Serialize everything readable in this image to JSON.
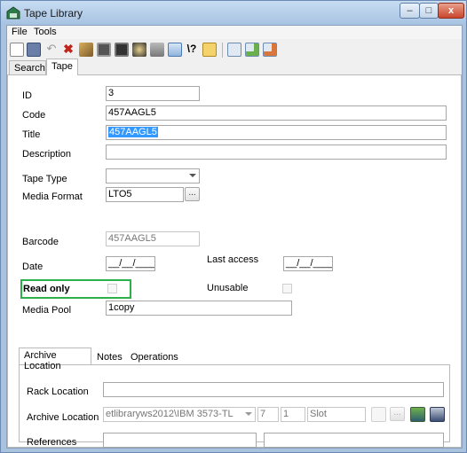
{
  "window": {
    "title": "Tape Library",
    "buttons": {
      "minimize": "–",
      "maximize": "□",
      "close": "x"
    }
  },
  "menu": [
    "File",
    "Tools"
  ],
  "toolbar": [
    "new-icon",
    "save-icon",
    "undo-icon",
    "delete-icon",
    "brush-icon",
    "print-icon",
    "print-preview-icon",
    "process-icon",
    "copy-icon",
    "screen-icon",
    "help-icon",
    "lock-icon",
    "tape-icon",
    "tape-add-icon",
    "tape-remove-icon"
  ],
  "tabs": [
    "Search",
    "Tape"
  ],
  "form": {
    "id_label": "ID",
    "id_value": "3",
    "code_label": "Code",
    "code_value": "457AAGL5",
    "title_label": "Title",
    "title_value": "457AAGL5",
    "description_label": "Description",
    "description_value": "",
    "tape_type_label": "Tape Type",
    "tape_type_value": "",
    "media_format_label": "Media Format",
    "media_format_value": "LTO5",
    "ellipsis": "...",
    "barcode_label": "Barcode",
    "barcode_value": "457AAGL5",
    "date_label": "Date",
    "date_value": "__/__/____",
    "last_access_label": "Last access",
    "last_access_value": "__/__/____",
    "read_only_label": "Read only",
    "unusable_label": "Unusable",
    "media_pool_label": "Media Pool",
    "media_pool_value": "1copy"
  },
  "subtabs": [
    "Archive Location",
    "Notes",
    "Operations"
  ],
  "archive": {
    "rack_label": "Rack Location",
    "rack_value": "",
    "archive_label": "Archive Location",
    "archive_value": "etlibraryws2012\\IBM 3573-TL",
    "num1": "7",
    "num2": "1",
    "slot": "Slot",
    "ellipsis": "...",
    "references_label": "References",
    "ref1": "",
    "ref2": ""
  },
  "colors": {
    "accent_highlight": "#2bb04a",
    "selection": "#3399ff"
  }
}
